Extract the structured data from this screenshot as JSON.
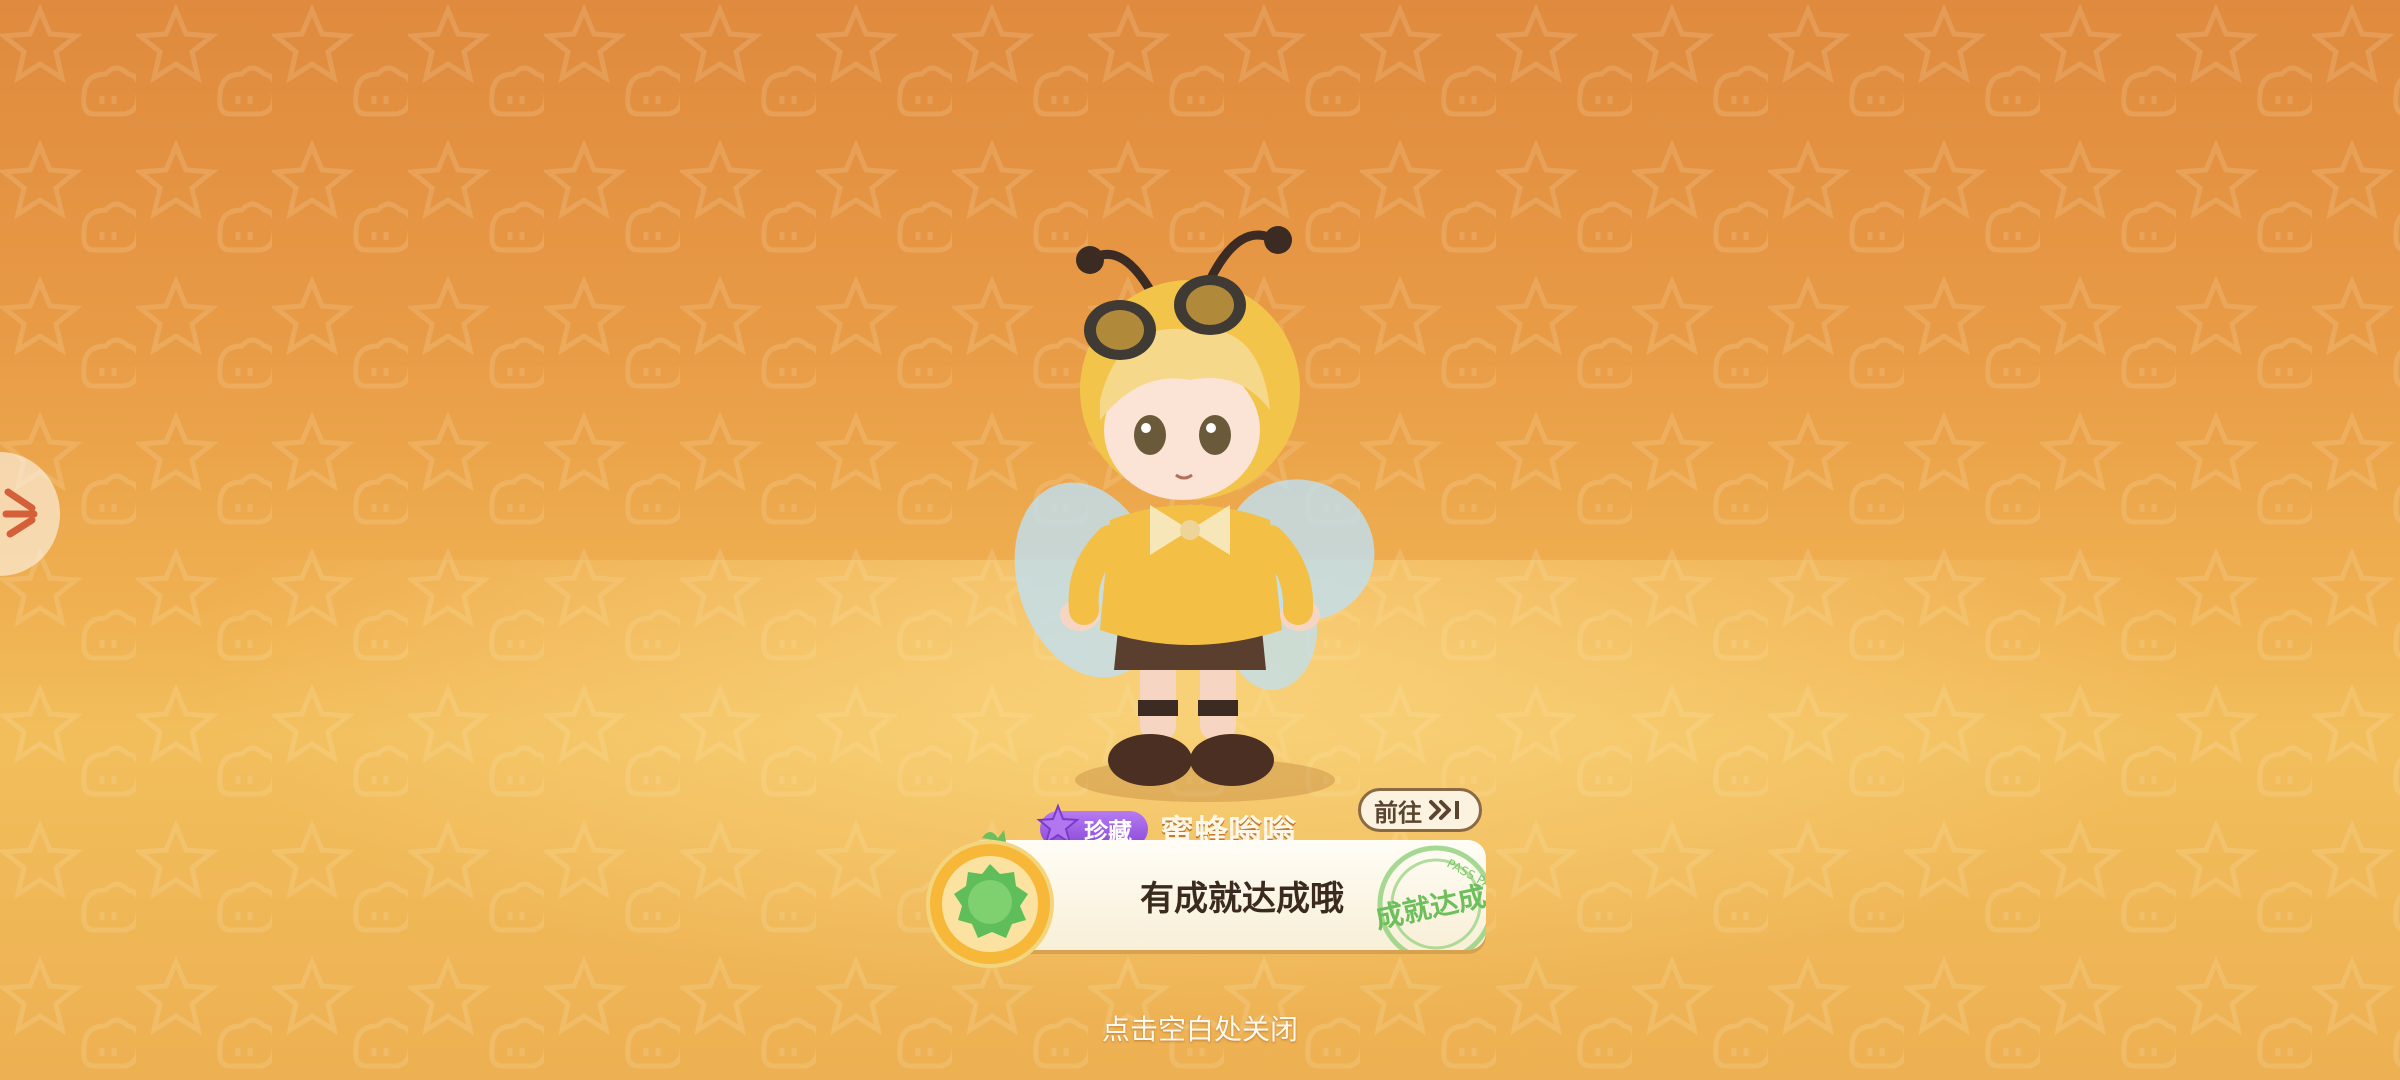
{
  "reward": {
    "rarity_label": "珍藏",
    "item_name": "蜜蜂嗡嗡",
    "goto_label": "前往"
  },
  "achievement": {
    "title": "有成就达成哦",
    "stamp_text": "成就达成",
    "stamp_ring_text": "PASS PASS"
  },
  "close_hint": "点击空白处关闭",
  "colors": {
    "background_top": "#df8a3e",
    "background_bottom": "#f2be5c",
    "rarity_purple": "#8a48d8",
    "medal_green": "#5fbe5a",
    "stamp_green": "#6cbf5b"
  },
  "icons": [
    "star-icon",
    "skip-forward-icon",
    "medal-icon",
    "stamp-icon",
    "side-menu-icon"
  ]
}
